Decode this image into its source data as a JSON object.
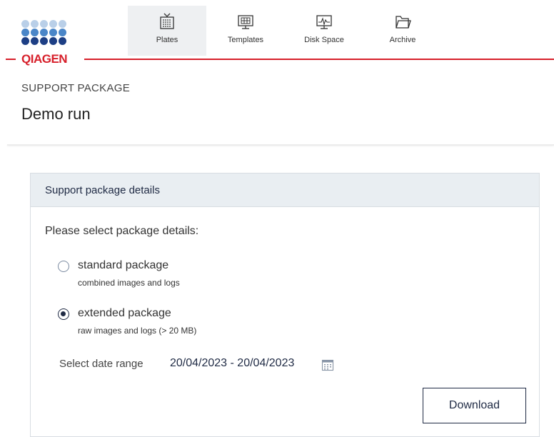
{
  "brand": {
    "name": "QIAGEN",
    "color": "#d71f2a"
  },
  "nav": {
    "items": [
      {
        "label": "Plates",
        "icon": "plate-icon",
        "active": true
      },
      {
        "label": "Templates",
        "icon": "template-icon",
        "active": false
      },
      {
        "label": "Disk Space",
        "icon": "disk-space-icon",
        "active": false
      },
      {
        "label": "Archive",
        "icon": "folder-icon",
        "active": false
      }
    ]
  },
  "page": {
    "subtitle": "SUPPORT PACKAGE",
    "title": "Demo run"
  },
  "card": {
    "header": "Support package details",
    "prompt": "Please select package details:",
    "options": [
      {
        "label": "standard package",
        "description": "combined images and logs",
        "selected": false
      },
      {
        "label": "extended package",
        "description": "raw images and logs (> 20 MB)",
        "selected": true
      }
    ],
    "date_range": {
      "label": "Select date range",
      "value": "20/04/2023 - 20/04/2023",
      "icon": "calendar-icon"
    },
    "download_label": "Download"
  },
  "colors": {
    "accent": "#1f2a44",
    "header_bg": "#e9eef2",
    "active_nav_bg": "#eef0f2"
  }
}
